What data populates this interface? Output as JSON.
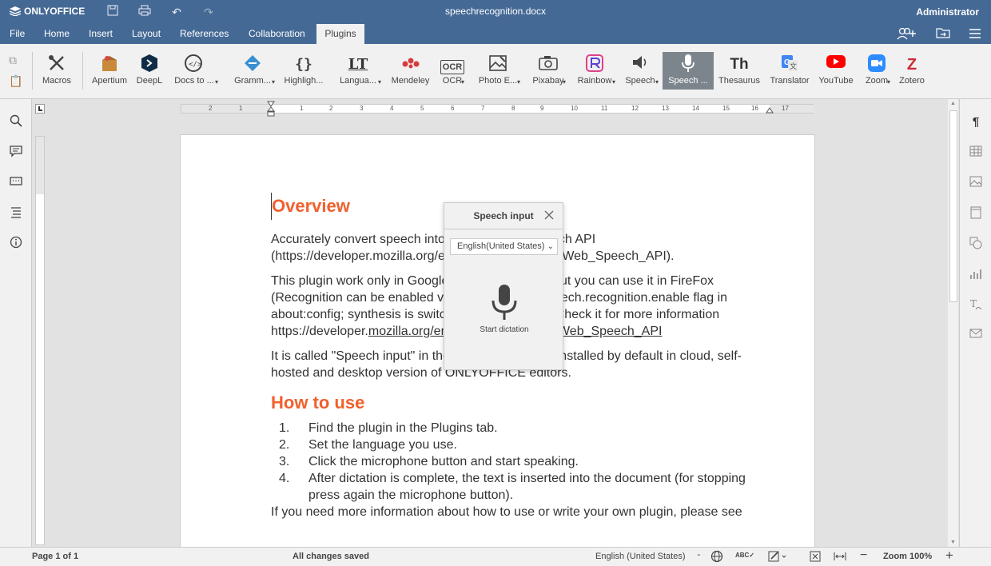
{
  "header": {
    "app_name": "ONLYOFFICE",
    "doc_title": "speechrecognition.docx",
    "user": "Administrator"
  },
  "menu": {
    "tabs": [
      "File",
      "Home",
      "Insert",
      "Layout",
      "References",
      "Collaboration",
      "Plugins"
    ],
    "active_tab": "Plugins"
  },
  "toolbar": {
    "tools": [
      {
        "label": "Macros",
        "icon": "macros-icon"
      },
      {
        "label": "Apertium",
        "icon": "apertium-icon"
      },
      {
        "label": "DeepL",
        "icon": "deepl-icon"
      },
      {
        "label": "Docs to ...",
        "icon": "docs-icon"
      },
      {
        "label": "Gramm...",
        "icon": "grammalecte-icon"
      },
      {
        "label": "Highligh...",
        "icon": "highlight-icon"
      },
      {
        "label": "Langua...",
        "icon": "languagetool-icon"
      },
      {
        "label": "Mendeley",
        "icon": "mendeley-icon"
      },
      {
        "label": "OCR",
        "icon": "ocr-icon"
      },
      {
        "label": "Photo E...",
        "icon": "photo-editor-icon"
      },
      {
        "label": "Pixabay",
        "icon": "pixabay-icon"
      },
      {
        "label": "Rainbow",
        "icon": "rainbow-icon"
      },
      {
        "label": "Speech",
        "icon": "speech-icon"
      },
      {
        "label": "Speech ...",
        "icon": "microphone-icon"
      },
      {
        "label": "Thesaurus",
        "icon": "thesaurus-icon"
      },
      {
        "label": "Translator",
        "icon": "translator-icon"
      },
      {
        "label": "YouTube",
        "icon": "youtube-icon"
      },
      {
        "label": "Zoom",
        "icon": "zoom-icon"
      },
      {
        "label": "Zotero",
        "icon": "zotero-icon"
      }
    ],
    "icon_text": {
      "thesaurus": "Th",
      "ocr": "OCR",
      "highlight": "{}",
      "languagetool": "LT",
      "zotero": "Z"
    }
  },
  "ruler": {
    "numbers": [
      "2",
      "1",
      "1",
      "2",
      "3",
      "4",
      "5",
      "6",
      "7",
      "8",
      "9",
      "10",
      "11",
      "12",
      "13",
      "14",
      "15",
      "16",
      "17"
    ]
  },
  "document": {
    "heading1": "Overview",
    "p1": "Accurately convert speech into text with Web Speech API (https://developer.mozilla.org/en-US/docs/Web/API/Web_Speech_API).",
    "p2_before": "This plugin work only in Google Chrome browser, but you can use it in FireFox (Recognition can be enabled via the media.webspeech.recognition.enable flag in about:config; synthesis is switched on by default). Check it for more information https://developer.",
    "p2_link": "mozilla.org/en-US/docs/Web/API/Web_Speech_API",
    "p3": "It is called \"Speech input\" in the interface and isn't installed by default in cloud, self-hosted and desktop version of ONLYOFFICE editors.",
    "heading2": "How to use",
    "steps": [
      "Find the plugin in the Plugins tab.",
      "Set the language you use.",
      "Click the microphone button and start speaking.",
      "After dictation is complete, the text is inserted into the document (for stopping press again the microphone button)."
    ],
    "p4": "If you need more information about how to use or write your own plugin, please see"
  },
  "dialog": {
    "title": "Speech input",
    "language": "English(United States)",
    "button_label": "Start dictation"
  },
  "status": {
    "page": "Page 1 of 1",
    "saved": "All changes saved",
    "language": "English (United States)",
    "zoom": "Zoom 100%"
  },
  "colors": {
    "header": "#446995",
    "heading": "#f1602d",
    "active_tool": "#7d858c"
  }
}
